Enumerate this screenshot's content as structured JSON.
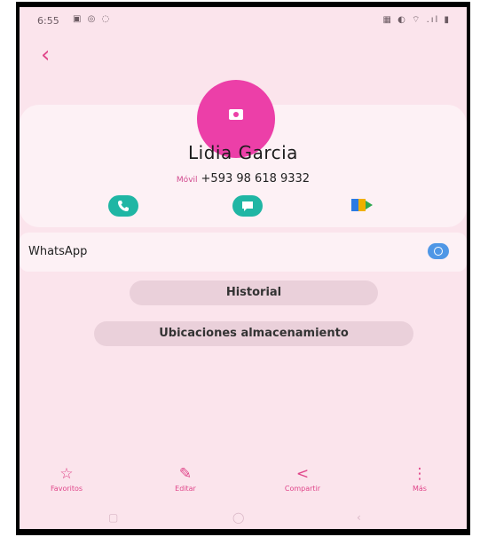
{
  "status_bar": {
    "time": "6:55",
    "left_icons": "▣ ◎ ◌",
    "right_icons": "▦ ◐ ⌔ .ıl ▮"
  },
  "contact": {
    "name": "Lidia Garcia",
    "phone_label": "Móvil",
    "phone_number": "+593 98 618 9332"
  },
  "actions": [
    "call-icon",
    "message-icon",
    "google-meet-icon"
  ],
  "whatsapp": {
    "label": "WhatsApp"
  },
  "buttons": {
    "history": "Historial",
    "storage_locations": "Ubicaciones almacenamiento"
  },
  "bottom_nav": {
    "favorites": "Favoritos",
    "edit": "Editar",
    "share": "Compartir",
    "more": "Más"
  },
  "colors": {
    "accent": "#e0468a",
    "avatar": "#ec3fa8",
    "action_teal": "#1fb6a4",
    "background": "#fbe4ec"
  }
}
